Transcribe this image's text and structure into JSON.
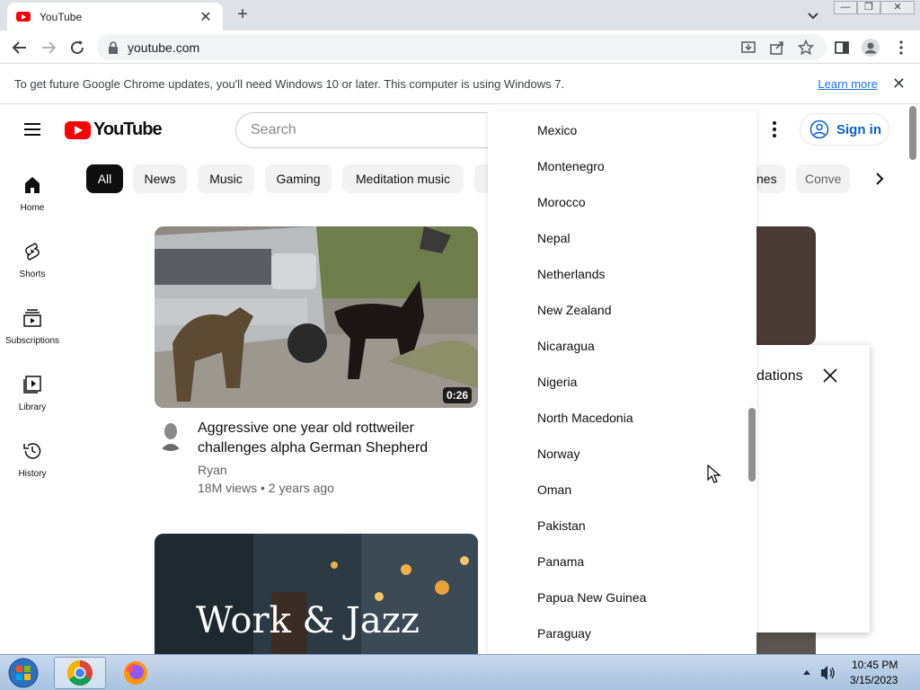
{
  "browser": {
    "tab_title": "YouTube",
    "tab_close": "✕",
    "new_tab": "+",
    "url": "youtube.com",
    "window_controls": {
      "minimize": "—",
      "restore": "❐",
      "close": "✕"
    }
  },
  "infobar": {
    "message": "To get future Google Chrome updates, you'll need Windows 10 or later. This computer is using Windows 7.",
    "learn_more": "Learn more",
    "close": "✕"
  },
  "youtube": {
    "logo_text": "YouTube",
    "search_placeholder": "Search",
    "sign_in": "Sign in",
    "chips": [
      "All",
      "News",
      "Music",
      "Gaming",
      "Meditation music"
    ],
    "chips_partial_right": [
      "nes",
      "Conve"
    ],
    "sidebar": [
      {
        "label": "Home",
        "icon": "home-icon"
      },
      {
        "label": "Shorts",
        "icon": "shorts-icon"
      },
      {
        "label": "Subscriptions",
        "icon": "subscriptions-icon"
      },
      {
        "label": "Library",
        "icon": "library-icon"
      },
      {
        "label": "History",
        "icon": "history-icon"
      }
    ],
    "videos": [
      {
        "title": "Aggressive one year old rottweiler challenges alpha German Shepherd",
        "channel": "Ryan",
        "meta": "18M views • 2 years ago",
        "duration": "0:26"
      },
      {
        "thumbnail_text": "Work & Jazz"
      }
    ],
    "background_popup_text": "dations"
  },
  "dropdown": {
    "countries": [
      "Mexico",
      "Montenegro",
      "Morocco",
      "Nepal",
      "Netherlands",
      "New Zealand",
      "Nicaragua",
      "Nigeria",
      "North Macedonia",
      "Norway",
      "Oman",
      "Pakistan",
      "Panama",
      "Papua New Guinea",
      "Paraguay"
    ]
  },
  "taskbar": {
    "time": "10:45 PM",
    "date": "3/15/2023"
  },
  "colors": {
    "yt_red": "#ff0000",
    "link_blue": "#1a73e8",
    "signin_blue": "#065fd4",
    "chip_bg": "#f2f2f2",
    "chip_active_bg": "#0f0f0f"
  }
}
